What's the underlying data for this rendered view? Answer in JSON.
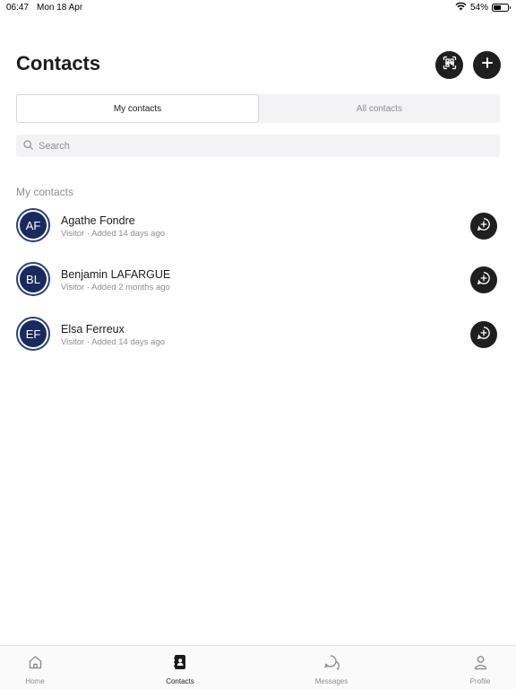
{
  "status_bar": {
    "time": "06:47",
    "date": "Mon 18 Apr",
    "battery_text": "54%",
    "battery_level": 0.54
  },
  "header": {
    "title": "Contacts",
    "scan_icon": "qr-scan-icon",
    "add_icon": "plus-icon"
  },
  "tabs": {
    "my_contacts": "My contacts",
    "all_contacts": "All contacts",
    "active": "my_contacts"
  },
  "search": {
    "placeholder": "Search",
    "value": ""
  },
  "section": {
    "title": "My contacts"
  },
  "contacts": [
    {
      "initials": "AF",
      "name": "Agathe Fondre",
      "meta": "Visitor · Added 14 days ago"
    },
    {
      "initials": "BL",
      "name": "Benjamin LAFARGUE",
      "meta": "Visitor · Added 2 months ago"
    },
    {
      "initials": "EF",
      "name": "Elsa Ferreux",
      "meta": "Visitor · Added 14 days ago"
    }
  ],
  "bottom_nav": {
    "home": "Home",
    "contacts": "Contacts",
    "messages": "Messages",
    "profile": "Profile",
    "active": "contacts"
  },
  "colors": {
    "avatar_bg": "#1a2a5e",
    "avatar_ring": "#2a3f80",
    "button_dark": "#1f1f1f",
    "muted_text": "#8e8e93"
  }
}
